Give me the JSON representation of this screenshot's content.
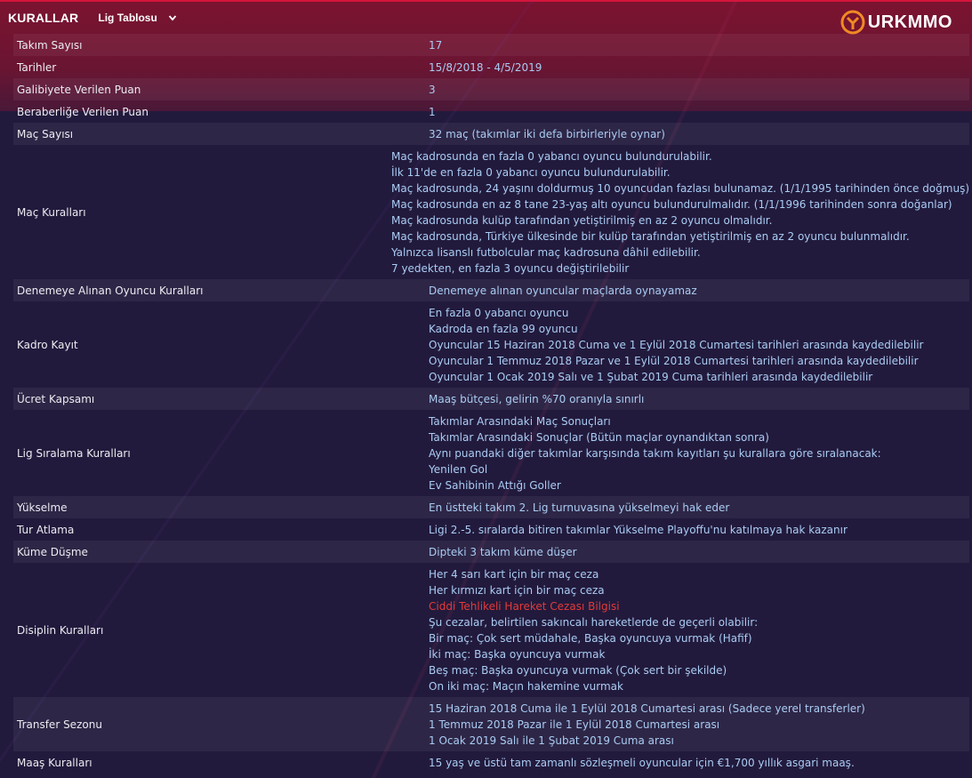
{
  "header": {
    "title": "KURALLAR",
    "dropdown_label": "Lig Tablosu",
    "logo_text": "URKMMO"
  },
  "colors": {
    "accent_red": "#d4143c",
    "value_blue": "#a9ccf4",
    "warning_red": "#e23a3a",
    "logo_orange": "#f08a24"
  },
  "rules": [
    {
      "label": "Takım Sayısı",
      "lines": [
        "17"
      ]
    },
    {
      "label": "Tarihler",
      "lines": [
        "15/8/2018 - 4/5/2019"
      ]
    },
    {
      "label": "Galibiyete Verilen Puan",
      "lines": [
        "3"
      ]
    },
    {
      "label": "Beraberliğe Verilen Puan",
      "lines": [
        "1"
      ]
    },
    {
      "label": "Maç Sayısı",
      "lines": [
        "32 maç (takımlar iki defa birbirleriyle oynar)"
      ]
    },
    {
      "label": "Maç Kuralları",
      "lines": [
        "Maç kadrosunda en fazla 0 yabancı oyuncu bulundurulabilir.",
        "İlk 11'de en fazla 0 yabancı oyuncu bulundurulabilir.",
        "Maç kadrosunda, 24 yaşını doldurmuş 10 oyuncudan fazlası bulunamaz. (1/1/1995 tarihinden önce doğmuş)",
        "Maç kadrosunda en az 8 tane 23-yaş altı oyuncu bulundurulmalıdır. (1/1/1996 tarihinden sonra doğanlar)",
        "Maç kadrosunda kulüp tarafından yetiştirilmiş en az 2 oyuncu olmalıdır.",
        "Maç kadrosunda, Türkiye ülkesinde bir kulüp tarafından yetiştirilmiş en az 2 oyuncu bulunmalıdır.",
        "Yalnızca lisanslı futbolcular maç kadrosuna dâhil edilebilir.",
        "7 yedekten, en fazla 3 oyuncu değiştirilebilir"
      ]
    },
    {
      "label": "Denemeye Alınan Oyuncu Kuralları",
      "lines": [
        "Denemeye alınan oyuncular maçlarda oynayamaz"
      ]
    },
    {
      "label": "Kadro Kayıt",
      "lines": [
        "En fazla 0 yabancı oyuncu",
        "Kadroda en fazla 99 oyuncu",
        "Oyuncular 15 Haziran 2018 Cuma ve 1 Eylül 2018 Cumartesi tarihleri arasında kaydedilebilir",
        "Oyuncular 1 Temmuz 2018 Pazar ve 1 Eylül 2018 Cumartesi tarihleri arasında kaydedilebilir",
        "Oyuncular 1 Ocak 2019 Salı ve 1 Şubat 2019 Cuma tarihleri arasında kaydedilebilir"
      ]
    },
    {
      "label": "Ücret Kapsamı",
      "lines": [
        "Maaş bütçesi, gelirin %70 oranıyla sınırlı"
      ]
    },
    {
      "label": "Lig Sıralama Kuralları",
      "lines": [
        "Takımlar Arasındaki Maç Sonuçları",
        "Takımlar Arasındaki Sonuçlar (Bütün maçlar oynandıktan sonra)",
        "Aynı puandaki diğer takımlar karşısında takım kayıtları şu kurallara göre sıralanacak:",
        "Yenilen Gol",
        "Ev Sahibinin Attığı Goller"
      ]
    },
    {
      "label": "Yükselme",
      "lines": [
        "En üstteki takım 2. Lig turnuvasına yükselmeyi hak eder"
      ]
    },
    {
      "label": "Tur Atlama",
      "lines": [
        "Ligi 2.-5. sıralarda bitiren takımlar Yükselme Playoffu'nu katılmaya hak kazanır"
      ]
    },
    {
      "label": "Küme Düşme",
      "lines": [
        "Dipteki 3 takım küme düşer"
      ]
    },
    {
      "label": "Disiplin Kuralları",
      "lines": [
        "Her 4 sarı kart için bir maç ceza",
        "Her kırmızı kart için bir maç ceza",
        "Ciddi Tehlikeli Hareket Cezası Bilgisi",
        "Şu cezalar, belirtilen sakıncalı hareketlerde de geçerli olabilir:",
        "Bir maç: Çok sert müdahale, Başka oyuncuya vurmak (Hafif)",
        "İki maç: Başka oyuncuya vurmak",
        "Beş maç: Başka oyuncuya vurmak (Çok sert bir şekilde)",
        "On iki maç: Maçın hakemine vurmak"
      ],
      "highlight_line": 2
    },
    {
      "label": "Transfer Sezonu",
      "lines": [
        "15 Haziran 2018 Cuma ile 1 Eylül 2018 Cumartesi arası (Sadece yerel transferler)",
        "1 Temmuz 2018 Pazar ile 1 Eylül 2018 Cumartesi arası",
        "1 Ocak 2019 Salı ile 1 Şubat 2019 Cuma arası"
      ]
    },
    {
      "label": "Maaş Kuralları",
      "lines": [
        "15 yaş ve üstü tam zamanlı sözleşmeli oyuncular için €1,700 yıllık asgari maaş."
      ]
    }
  ]
}
